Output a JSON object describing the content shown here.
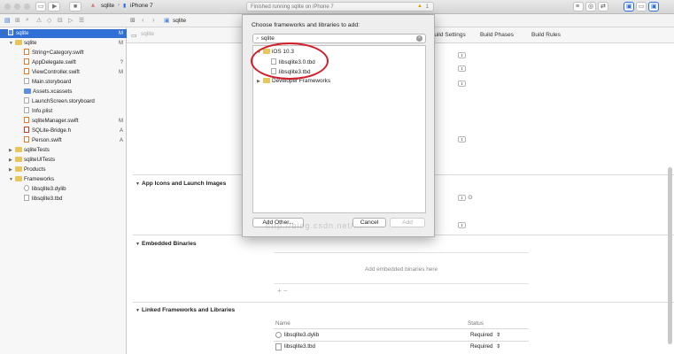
{
  "toolbar": {
    "scheme_app": "sqlite",
    "scheme_device": "iPhone 7",
    "activity_text": "Finished running sqlite on iPhone 7",
    "warning_count": "1"
  },
  "jumpbar": {
    "crumb": "sqlite"
  },
  "navigator": {
    "items": [
      {
        "label": "sqlite",
        "badge": "M"
      },
      {
        "label": "sqlite",
        "badge": "M"
      },
      {
        "label": "String+Category.swift",
        "badge": ""
      },
      {
        "label": "AppDelegate.swift",
        "badge": "?"
      },
      {
        "label": "ViewController.swift",
        "badge": "M"
      },
      {
        "label": "Main.storyboard",
        "badge": ""
      },
      {
        "label": "Assets.xcassets",
        "badge": ""
      },
      {
        "label": "LaunchScreen.storyboard",
        "badge": ""
      },
      {
        "label": "Info.plist",
        "badge": ""
      },
      {
        "label": "sqliteManager.swift",
        "badge": "M"
      },
      {
        "label": "SQLite-Bridge.h",
        "badge": "A"
      },
      {
        "label": "Person.swift",
        "badge": "A"
      },
      {
        "label": "sqliteTests",
        "badge": ""
      },
      {
        "label": "sqliteUITests",
        "badge": ""
      },
      {
        "label": "Products",
        "badge": ""
      },
      {
        "label": "Frameworks",
        "badge": ""
      },
      {
        "label": "libsqlite3.dylib",
        "badge": ""
      },
      {
        "label": "libsqlite3.tbd",
        "badge": ""
      }
    ]
  },
  "editor": {
    "target_selector": "sqlite",
    "tabs": [
      "Build Settings",
      "Build Phases",
      "Build Rules"
    ],
    "sections": {
      "app_icons": "App Icons and Launch Images",
      "embedded": "Embedded Binaries",
      "embedded_placeholder": "Add embedded binaries here",
      "linked": "Linked Frameworks and Libraries"
    },
    "linked_table": {
      "columns": [
        "Name",
        "Status"
      ],
      "rows": [
        {
          "name": "libsqlite3.dylib",
          "status": "Required"
        },
        {
          "name": "libsqlite3.tbd",
          "status": "Required"
        }
      ]
    },
    "add_remove": "+ −"
  },
  "dialog": {
    "title": "Choose frameworks and libraries to add:",
    "search_value": "sqlite",
    "tree": [
      {
        "label": "iOS 10.3"
      },
      {
        "label": "libsqlite3.0.tbd"
      },
      {
        "label": "libsqlite3.tbd"
      },
      {
        "label": "Developer Frameworks"
      }
    ],
    "add_other": "Add Other...",
    "cancel": "Cancel",
    "add": "Add"
  },
  "watermark": "http://blog.csdn.net/...",
  "colors": {
    "selection": "#2f6fd6",
    "annotation": "#d21f2c",
    "folder": "#e8c65a"
  }
}
